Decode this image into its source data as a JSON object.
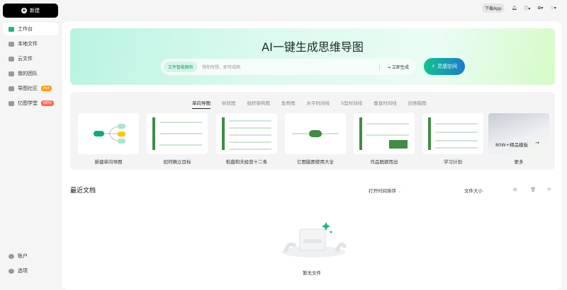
{
  "sidebar": {
    "new_label": "新建",
    "items": [
      {
        "label": "工作台"
      },
      {
        "label": "本地文件"
      },
      {
        "label": "云文件"
      },
      {
        "label": "我的团队"
      },
      {
        "label": "导图社区",
        "badge": "Hot"
      },
      {
        "label": "亿图学堂",
        "badge": "NEW"
      }
    ],
    "account": "账户",
    "options": "选项"
  },
  "topbar": {
    "download": "下载App"
  },
  "banner": {
    "title": "AI一键生成思维导图",
    "chip": "文件智能解析",
    "placeholder": "想你所想，即可成图",
    "generate": "立即生成",
    "inspire": "灵感空间"
  },
  "templates": {
    "tabs": [
      "单向导图",
      "树状图",
      "组织架构图",
      "鱼骨图",
      "水平时间线",
      "S型时间线",
      "垂直时间线",
      "创意脑图"
    ],
    "cards": [
      "新建单向导图",
      "如何确立目标",
      "稻盛和夫经营十二条",
      "亿图脑图使用大全",
      "作品脱颖而出",
      "学习计划",
      "更多"
    ],
    "more_text": "80W+精品模板"
  },
  "recent": {
    "title": "最近文档",
    "sort": "打开时间排序",
    "size": "文件大小",
    "empty": "暂无文件"
  },
  "colors": {
    "accent": "#1dba7e",
    "hot": "#ff9f1a",
    "new": "#ff6a4d"
  }
}
